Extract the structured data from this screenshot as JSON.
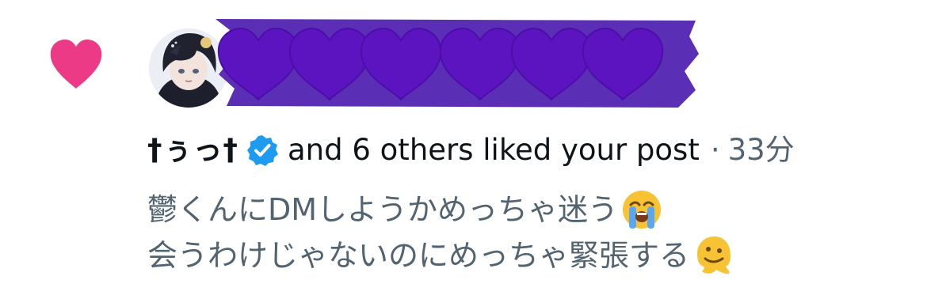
{
  "notification": {
    "type": "like",
    "icons": {
      "like": "heart-icon",
      "verified": "verified-badge-icon",
      "loudly_crying": "loudly-crying-face-emoji",
      "melting": "melting-face-emoji"
    },
    "colors": {
      "heart": "#f91880",
      "verified": "#1d9bf0",
      "redaction": "#5a2fb6",
      "redaction_heart": "#5c14c0",
      "primary_text": "#0f1419",
      "secondary_text": "#536471"
    },
    "user_name": "†ぅっ†",
    "liked_text": "and 6 others liked your post",
    "separator": "·",
    "timestamp": "33分",
    "post_lines": [
      "鬱くんにDMしようかめっちゃ迷う",
      "会うわけじゃないのにめっちゃ緊張する"
    ]
  }
}
